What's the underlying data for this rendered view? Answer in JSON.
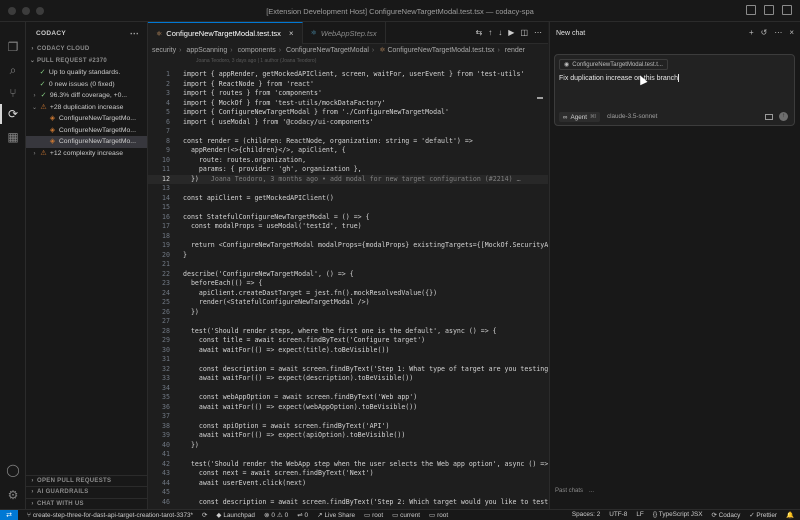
{
  "window": {
    "title": "[Extension Development Host] ConfigureNewTargetModal.test.tsx — codacy-spa"
  },
  "sidebar": {
    "title": "CODACY",
    "sections": [
      {
        "label": "CODACY CLOUD",
        "chevron": ">"
      },
      {
        "label": "PULL REQUEST #2370",
        "chevron": "v"
      }
    ],
    "items": [
      {
        "label": "Up to quality standards.",
        "icon": "✓",
        "kind": "ok"
      },
      {
        "label": "0 new issues (0 fixed)",
        "icon": "✓",
        "kind": "ok"
      },
      {
        "label": "96.3% diff coverage, +0...",
        "icon": "✓",
        "kind": "ok"
      },
      {
        "label": "+28 duplication increase",
        "icon": "⚠",
        "kind": "warn"
      },
      {
        "label": "ConfigureNewTargetMo...",
        "icon": "◈",
        "kind": "warn"
      },
      {
        "label": "ConfigureNewTargetMo...",
        "icon": "◈",
        "kind": "warn"
      },
      {
        "label": "ConfigureNewTargetMo...",
        "icon": "◈",
        "kind": "warn"
      },
      {
        "label": "+12 complexity increase",
        "icon": "⚠",
        "kind": "warn"
      }
    ],
    "bottom": [
      "OPEN PULL REQUESTS",
      "AI GUARDRAILS",
      "CHAT WITH US"
    ]
  },
  "editor": {
    "tabs": [
      {
        "label": "ConfigureNewTargetModal.test.tsx",
        "active": true
      },
      {
        "label": "WebAppStep.tsx",
        "active": false
      }
    ],
    "breadcrumb": [
      "security",
      "appScanning",
      "components",
      "ConfigureNewTargetModal",
      "ConfigureNewTargetModal.test.tsx",
      "render"
    ],
    "blame_header": "Joana Teodoro, 3 days ago | 1 author (Joana Teodoro)",
    "current_line": 12,
    "lines": [
      {
        "n": "1",
        "text": "import { appRender, getMockedAPIClient, screen, waitFor, userEvent } from 'test-utils'"
      },
      {
        "n": "2",
        "text": "import { ReactNode } from 'react'"
      },
      {
        "n": "3",
        "text": "import { routes } from 'components'"
      },
      {
        "n": "4",
        "text": "import { MockOf } from 'test-utils/mockDataFactory'"
      },
      {
        "n": "5",
        "text": "import { ConfigureNewTargetModal } from './ConfigureNewTargetModal'"
      },
      {
        "n": "6",
        "text": "import { useModal } from '@codacy/ui-components'"
      },
      {
        "n": "7",
        "text": ""
      },
      {
        "n": "8",
        "text": "const render = (children: ReactNode, organization: string = 'default') =>"
      },
      {
        "n": "9",
        "text": "  appRender(<>{children}</>, apiClient, {"
      },
      {
        "n": "10",
        "text": "    route: routes.organization,"
      },
      {
        "n": "11",
        "text": "    params: { provider: 'gh', organization },"
      },
      {
        "n": "12",
        "text": "  })",
        "blame": "Joana Teodoro, 3 months ago • add modal for new target configuration (#2214) …"
      },
      {
        "n": "13",
        "text": ""
      },
      {
        "n": "14",
        "text": "const apiClient = getMockedAPIClient()"
      },
      {
        "n": "15",
        "text": ""
      },
      {
        "n": "16",
        "text": "const StatefulConfigureNewTargetModal = () => {"
      },
      {
        "n": "17",
        "text": "  const modalProps = useModal('testId', true)"
      },
      {
        "n": "18",
        "text": ""
      },
      {
        "n": "19",
        "text": "  return <ConfigureNewTargetModal modalProps={modalProps} existingTargets={[MockOf.SecurityAndR"
      },
      {
        "n": "20",
        "text": "}"
      },
      {
        "n": "21",
        "text": ""
      },
      {
        "n": "22",
        "text": "describe('ConfigureNewTargetModal', () => {"
      },
      {
        "n": "23",
        "text": "  beforeEach(() => {"
      },
      {
        "n": "24",
        "text": "    apiClient.createDastTarget = jest.fn().mockResolvedValue({})"
      },
      {
        "n": "25",
        "text": "    render(<StatefulConfigureNewTargetModal />)"
      },
      {
        "n": "26",
        "text": "  })"
      },
      {
        "n": "27",
        "text": ""
      },
      {
        "n": "28",
        "text": "  test('Should render steps, where the first one is the default', async () => {"
      },
      {
        "n": "29",
        "text": "    const title = await screen.findByText('Configure target')"
      },
      {
        "n": "30",
        "text": "    await waitFor(() => expect(title).toBeVisible())"
      },
      {
        "n": "31",
        "text": ""
      },
      {
        "n": "32",
        "text": "    const description = await screen.findByText('Step 1: What type of target are you testing?')"
      },
      {
        "n": "33",
        "text": "    await waitFor(() => expect(description).toBeVisible())"
      },
      {
        "n": "34",
        "text": ""
      },
      {
        "n": "35",
        "text": "    const webAppOption = await screen.findByText('Web app')"
      },
      {
        "n": "36",
        "text": "    await waitFor(() => expect(webAppOption).toBeVisible())"
      },
      {
        "n": "37",
        "text": ""
      },
      {
        "n": "38",
        "text": "    const apiOption = await screen.findByText('API')"
      },
      {
        "n": "39",
        "text": "    await waitFor(() => expect(apiOption).toBeVisible())"
      },
      {
        "n": "40",
        "text": "  })"
      },
      {
        "n": "41",
        "text": ""
      },
      {
        "n": "42",
        "text": "  test('Should render the WebApp step when the user selects the Web app option', async () => {"
      },
      {
        "n": "43",
        "text": "    const next = await screen.findByText('Next')"
      },
      {
        "n": "44",
        "text": "    await userEvent.click(next)"
      },
      {
        "n": "45",
        "text": ""
      },
      {
        "n": "46",
        "text": "    const description = await screen.findByText('Step 2: Which target would you like to test?')"
      }
    ]
  },
  "chat": {
    "title": "New chat",
    "context_chip": "ConfigureNewTargetModal.test.t...",
    "input_value": "Fix duplication increase on this branch",
    "mode_label": "Agent",
    "mode_shortcut": "⌘I",
    "model": "claude-3.5-sonnet",
    "past_chats": "Past chats",
    "past_dots": "..."
  },
  "status": {
    "branch": "create-step-three-for-dast-api-target-creation-tarot-3373*",
    "sync": "⟳",
    "launchpad": "Launchpad",
    "errors": "0",
    "warnings": "0",
    "ports": "0",
    "live_share": "Live Share",
    "root1": "root",
    "current": "current",
    "root2": "root",
    "spaces": "Spaces: 2",
    "encoding": "UTF-8",
    "eol": "LF",
    "language": "TypeScript JSX",
    "codacy": "Codacy",
    "prettier": "Prettier"
  }
}
